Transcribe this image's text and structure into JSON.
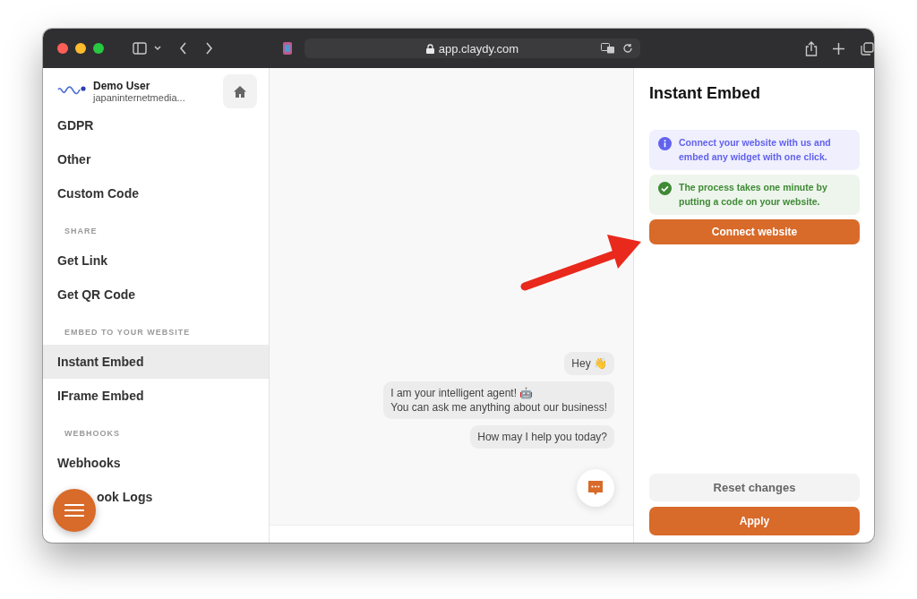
{
  "browser": {
    "url": "app.claydy.com"
  },
  "sidebar": {
    "user": {
      "name": "Demo User",
      "email": "japaninternetmedia..."
    },
    "items": [
      {
        "kind": "item",
        "label": "GDPR",
        "selected": false
      },
      {
        "kind": "item",
        "label": "Other",
        "selected": false
      },
      {
        "kind": "item",
        "label": "Custom Code",
        "selected": false
      },
      {
        "kind": "section",
        "label": "SHARE"
      },
      {
        "kind": "item",
        "label": "Get Link",
        "selected": false
      },
      {
        "kind": "item",
        "label": "Get QR Code",
        "selected": false
      },
      {
        "kind": "section",
        "label": "EMBED TO YOUR WEBSITE"
      },
      {
        "kind": "item",
        "label": "Instant Embed",
        "selected": true
      },
      {
        "kind": "item",
        "label": "IFrame Embed",
        "selected": false
      },
      {
        "kind": "section",
        "label": "WEBHOOKS"
      },
      {
        "kind": "item",
        "label": "Webhooks",
        "selected": false
      },
      {
        "kind": "covered",
        "label": "ook Logs",
        "selected": false
      }
    ]
  },
  "chat": {
    "messages": [
      {
        "lines": [
          "Hey 👋"
        ]
      },
      {
        "lines": [
          "I am your intelligent agent! 🤖",
          "You can ask me anything about our business!"
        ]
      },
      {
        "lines": [
          "How may I help you today?"
        ]
      }
    ]
  },
  "panel": {
    "title": "Instant Embed",
    "notices": [
      {
        "kind": "info",
        "text": "Connect your website with us and embed any widget with one click."
      },
      {
        "kind": "success",
        "text": "The process takes one minute by putting a code on your website."
      }
    ],
    "connect_button": "Connect website",
    "reset_button": "Reset changes",
    "apply_button": "Apply"
  }
}
